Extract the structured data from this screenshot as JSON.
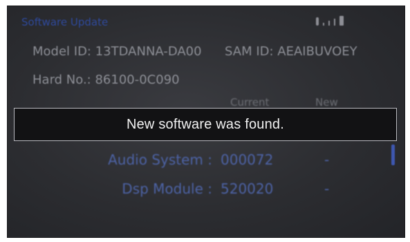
{
  "screen": {
    "title": "Software Update",
    "status_icons": [
      "bluetooth-icon",
      "signal-icon",
      "battery-icon"
    ]
  },
  "device_info": {
    "model_id": "Model ID: 13TDANNA-DA00",
    "sam_id": "SAM ID: AEAIBUVOEY",
    "hard_no": "Hard No.: 86100-0C090"
  },
  "table": {
    "headers": {
      "current": "Current",
      "new": "New"
    },
    "rows": [
      {
        "label": "Audio System :",
        "current": "000072",
        "new": "-"
      },
      {
        "label": "Dsp Module :",
        "current": "520020",
        "new": "-"
      }
    ]
  },
  "notification": {
    "message": "New software was found."
  },
  "colors": {
    "screen_bg": "#2c2d31",
    "title": "#2f4fb0",
    "info_text": "#8d8f96",
    "row_text": "#4d63a6",
    "toast_bg": "#121214",
    "toast_border": "#b9bac0",
    "toast_text": "#f2f2f2"
  }
}
